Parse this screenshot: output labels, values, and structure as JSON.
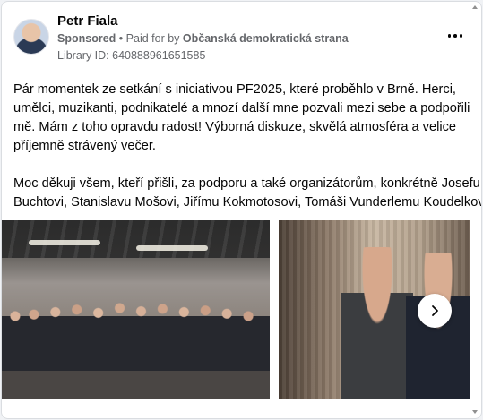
{
  "post": {
    "author": "Petr Fiala",
    "sponsored_label": "Sponsored",
    "separator": "•",
    "paid_for_prefix": "Paid for by",
    "payer": "Občanská demokratická strana",
    "library_id": "Library ID: 640888961651585",
    "text_lines": [
      "Pár momentek ze setkání s iniciativou PF2025, které proběhlo v Brně. Herci,",
      "umělci, muzikanti, podnikatelé a mnozí další mne pozvali mezi sebe a podpořili",
      "mě. Mám z toho opravdu radost! Výborná diskuze, skvělá atmosféra a velice",
      "příjemně strávený večer.",
      "Moc děkuji všem, kteří přišli, za podporu a také organizátorům, konkrétně Josefu",
      "Buchtovi, Stanislavu Mošovi, Jiřímu Kokmotosovi, Tomáši Vunderlemu Koudelkov..."
    ]
  },
  "icons": {
    "more": "more-horizontal-icon",
    "next": "chevron-right-icon"
  },
  "colors": {
    "text_primary": "#050505",
    "text_secondary": "#65676b",
    "card_border": "#dadde1"
  }
}
